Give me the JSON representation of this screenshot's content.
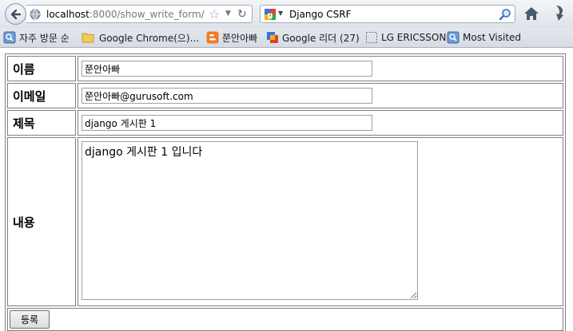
{
  "browser": {
    "url_host": "localhost",
    "url_path": ":8000/show_write_form/",
    "search_engine": "Django CSRF",
    "star_icon": "star-icon",
    "bookmarks": [
      {
        "label": "자주 방문 순",
        "icon": "bookmark-search-icon"
      },
      {
        "label": "Google Chrome(으)...",
        "icon": "folder-icon"
      },
      {
        "label": "쭌안아빠",
        "icon": "blogger-icon"
      },
      {
        "label": "Google 리더 (27)",
        "icon": "google-reader-icon"
      },
      {
        "label": "LG ERICSSON",
        "icon": "blank-page-icon"
      },
      {
        "label": "Most Visited",
        "icon": "bookmark-search-icon"
      }
    ]
  },
  "form": {
    "name_label": "이름",
    "name_value": "쭌안아빠",
    "email_label": "이메일",
    "email_value": "쭌안아빠@gurusoft.com",
    "subject_label": "제목",
    "subject_value": "django 게시판 1",
    "content_label": "내용",
    "content_value": "django 게시판 1 입니다",
    "submit_label": "등록"
  }
}
